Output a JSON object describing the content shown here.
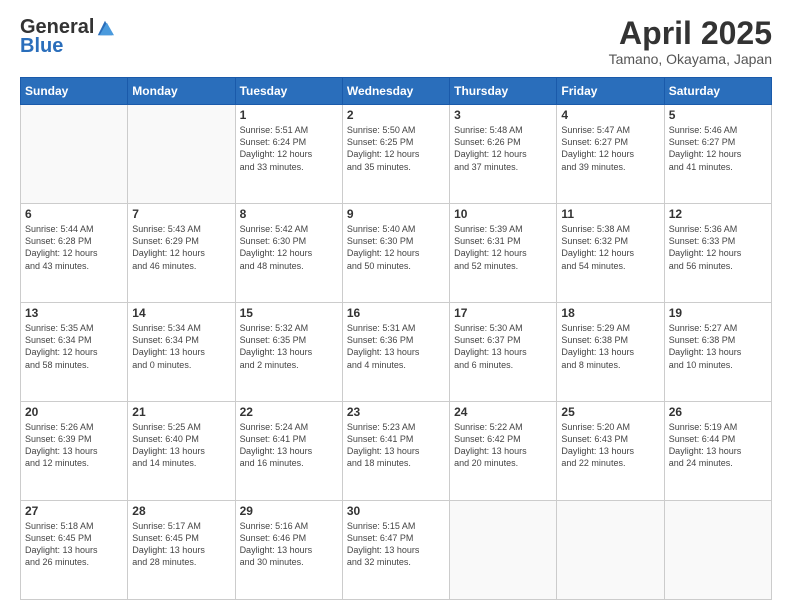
{
  "logo": {
    "general": "General",
    "blue": "Blue"
  },
  "header": {
    "month": "April 2025",
    "location": "Tamano, Okayama, Japan"
  },
  "weekdays": [
    "Sunday",
    "Monday",
    "Tuesday",
    "Wednesday",
    "Thursday",
    "Friday",
    "Saturday"
  ],
  "days": [
    {
      "date": 1,
      "col": 2,
      "sunrise": "5:51 AM",
      "sunset": "6:24 PM",
      "daylight": "12 hours and 33 minutes."
    },
    {
      "date": 2,
      "col": 3,
      "sunrise": "5:50 AM",
      "sunset": "6:25 PM",
      "daylight": "12 hours and 35 minutes."
    },
    {
      "date": 3,
      "col": 4,
      "sunrise": "5:48 AM",
      "sunset": "6:26 PM",
      "daylight": "12 hours and 37 minutes."
    },
    {
      "date": 4,
      "col": 5,
      "sunrise": "5:47 AM",
      "sunset": "6:27 PM",
      "daylight": "12 hours and 39 minutes."
    },
    {
      "date": 5,
      "col": 6,
      "sunrise": "5:46 AM",
      "sunset": "6:27 PM",
      "daylight": "12 hours and 41 minutes."
    },
    {
      "date": 6,
      "col": 0,
      "sunrise": "5:44 AM",
      "sunset": "6:28 PM",
      "daylight": "12 hours and 43 minutes."
    },
    {
      "date": 7,
      "col": 1,
      "sunrise": "5:43 AM",
      "sunset": "6:29 PM",
      "daylight": "12 hours and 46 minutes."
    },
    {
      "date": 8,
      "col": 2,
      "sunrise": "5:42 AM",
      "sunset": "6:30 PM",
      "daylight": "12 hours and 48 minutes."
    },
    {
      "date": 9,
      "col": 3,
      "sunrise": "5:40 AM",
      "sunset": "6:30 PM",
      "daylight": "12 hours and 50 minutes."
    },
    {
      "date": 10,
      "col": 4,
      "sunrise": "5:39 AM",
      "sunset": "6:31 PM",
      "daylight": "12 hours and 52 minutes."
    },
    {
      "date": 11,
      "col": 5,
      "sunrise": "5:38 AM",
      "sunset": "6:32 PM",
      "daylight": "12 hours and 54 minutes."
    },
    {
      "date": 12,
      "col": 6,
      "sunrise": "5:36 AM",
      "sunset": "6:33 PM",
      "daylight": "12 hours and 56 minutes."
    },
    {
      "date": 13,
      "col": 0,
      "sunrise": "5:35 AM",
      "sunset": "6:34 PM",
      "daylight": "12 hours and 58 minutes."
    },
    {
      "date": 14,
      "col": 1,
      "sunrise": "5:34 AM",
      "sunset": "6:34 PM",
      "daylight": "13 hours and 0 minutes."
    },
    {
      "date": 15,
      "col": 2,
      "sunrise": "5:32 AM",
      "sunset": "6:35 PM",
      "daylight": "13 hours and 2 minutes."
    },
    {
      "date": 16,
      "col": 3,
      "sunrise": "5:31 AM",
      "sunset": "6:36 PM",
      "daylight": "13 hours and 4 minutes."
    },
    {
      "date": 17,
      "col": 4,
      "sunrise": "5:30 AM",
      "sunset": "6:37 PM",
      "daylight": "13 hours and 6 minutes."
    },
    {
      "date": 18,
      "col": 5,
      "sunrise": "5:29 AM",
      "sunset": "6:38 PM",
      "daylight": "13 hours and 8 minutes."
    },
    {
      "date": 19,
      "col": 6,
      "sunrise": "5:27 AM",
      "sunset": "6:38 PM",
      "daylight": "13 hours and 10 minutes."
    },
    {
      "date": 20,
      "col": 0,
      "sunrise": "5:26 AM",
      "sunset": "6:39 PM",
      "daylight": "13 hours and 12 minutes."
    },
    {
      "date": 21,
      "col": 1,
      "sunrise": "5:25 AM",
      "sunset": "6:40 PM",
      "daylight": "13 hours and 14 minutes."
    },
    {
      "date": 22,
      "col": 2,
      "sunrise": "5:24 AM",
      "sunset": "6:41 PM",
      "daylight": "13 hours and 16 minutes."
    },
    {
      "date": 23,
      "col": 3,
      "sunrise": "5:23 AM",
      "sunset": "6:41 PM",
      "daylight": "13 hours and 18 minutes."
    },
    {
      "date": 24,
      "col": 4,
      "sunrise": "5:22 AM",
      "sunset": "6:42 PM",
      "daylight": "13 hours and 20 minutes."
    },
    {
      "date": 25,
      "col": 5,
      "sunrise": "5:20 AM",
      "sunset": "6:43 PM",
      "daylight": "13 hours and 22 minutes."
    },
    {
      "date": 26,
      "col": 6,
      "sunrise": "5:19 AM",
      "sunset": "6:44 PM",
      "daylight": "13 hours and 24 minutes."
    },
    {
      "date": 27,
      "col": 0,
      "sunrise": "5:18 AM",
      "sunset": "6:45 PM",
      "daylight": "13 hours and 26 minutes."
    },
    {
      "date": 28,
      "col": 1,
      "sunrise": "5:17 AM",
      "sunset": "6:45 PM",
      "daylight": "13 hours and 28 minutes."
    },
    {
      "date": 29,
      "col": 2,
      "sunrise": "5:16 AM",
      "sunset": "6:46 PM",
      "daylight": "13 hours and 30 minutes."
    },
    {
      "date": 30,
      "col": 3,
      "sunrise": "5:15 AM",
      "sunset": "6:47 PM",
      "daylight": "13 hours and 32 minutes."
    }
  ]
}
